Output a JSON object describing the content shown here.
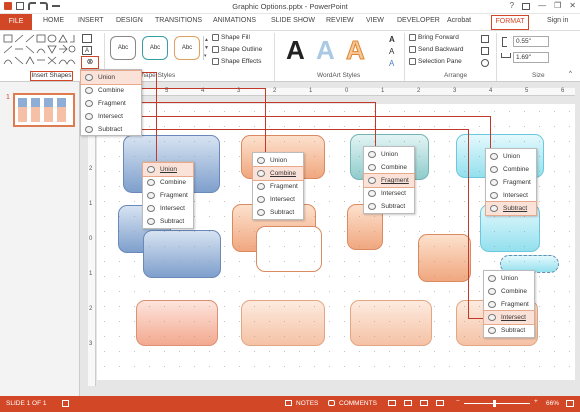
{
  "window": {
    "title": "Graphic Options.pptx - PowerPoint",
    "help": "?",
    "minimize": "—",
    "restore": "❐",
    "close": "✕"
  },
  "tabs": [
    "HOME",
    "INSERT",
    "DESIGN",
    "TRANSITIONS",
    "ANIMATIONS",
    "SLIDE SHOW",
    "REVIEW",
    "VIEW",
    "DEVELOPER",
    "Acrobat"
  ],
  "file_tab": "FILE",
  "format_tab": "FORMAT",
  "sign_in": "Sign in",
  "ribbon": {
    "shape_styles_samples": [
      "Abc",
      "Abc",
      "Abc"
    ],
    "shape_fill": "Shape Fill",
    "shape_outline": "Shape Outline",
    "shape_effects": "Shape Effects",
    "wordart_letters": [
      "A",
      "A",
      "A"
    ],
    "bring_forward": "Bring Forward",
    "send_backward": "Send Backward",
    "selection_pane": "Selection Pane",
    "height": "0.55\"",
    "width": "1.69\"",
    "group_insert_shapes": "Insert Shapes",
    "group_shape_styles": "Shape Styles",
    "group_wordart": "WordArt Styles",
    "group_arrange": "Arrange",
    "group_size": "Size"
  },
  "thumbnail": {
    "slide_number": "1"
  },
  "ruler_numbers": [
    "6",
    "5",
    "4",
    "3",
    "2",
    "1",
    "0",
    "1",
    "2",
    "3",
    "4",
    "5",
    "6"
  ],
  "vruler_numbers": [
    "2",
    "1",
    "0",
    "1",
    "2",
    "3"
  ],
  "merge_menu": [
    "Union",
    "Combine",
    "Fragment",
    "Intersect",
    "Subtract"
  ],
  "status": {
    "slide": "SLIDE 1 OF 1",
    "notes": "NOTES",
    "comments": "COMMENTS",
    "zoom": "66%",
    "zoom_minus": "−",
    "zoom_plus": "+"
  },
  "colors": {
    "accent": "#d24726",
    "blue_shape": "#7e9fcc",
    "orange_shape": "#f0a77f",
    "teal_shape": "#8fcccc",
    "cyan_shape": "#93e0ee"
  }
}
